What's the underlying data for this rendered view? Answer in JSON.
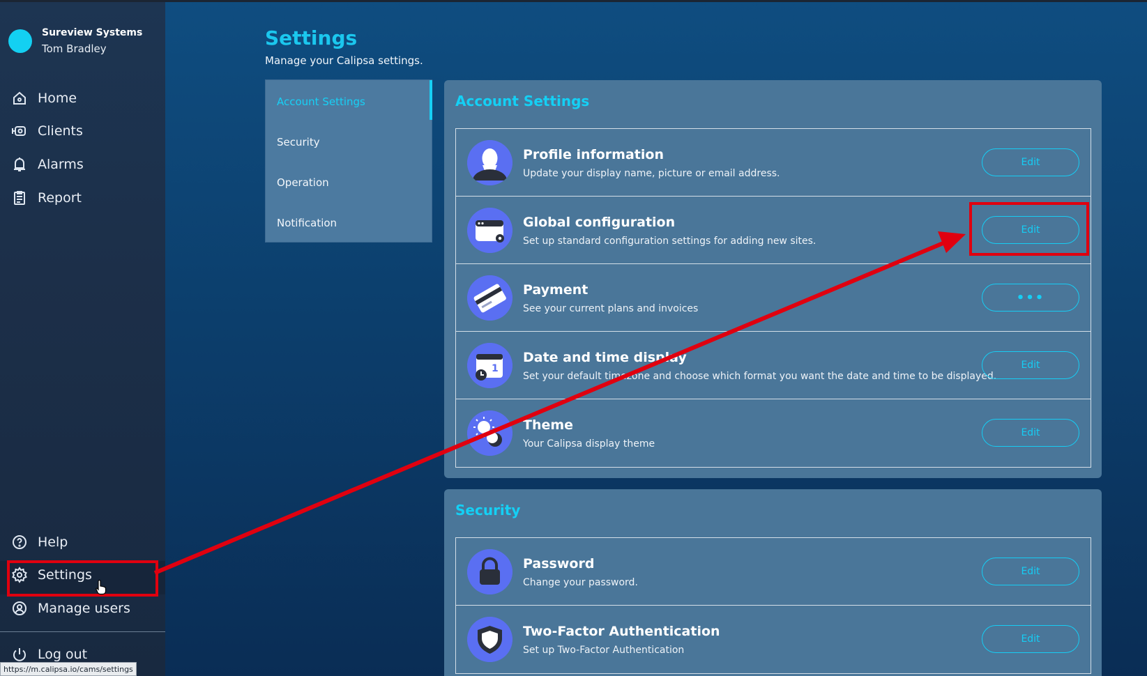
{
  "sidebar": {
    "org_name": "Sureview Systems",
    "user_name": "Tom Bradley",
    "nav_top": [
      {
        "label": "Home",
        "icon": "home-icon"
      },
      {
        "label": "Clients",
        "icon": "clients-icon"
      },
      {
        "label": "Alarms",
        "icon": "bell-icon"
      },
      {
        "label": "Report",
        "icon": "clipboard-icon"
      }
    ],
    "nav_bottom": [
      {
        "label": "Help",
        "icon": "help-icon"
      },
      {
        "label": "Settings",
        "icon": "gear-icon",
        "active": true
      },
      {
        "label": "Manage users",
        "icon": "user-icon"
      },
      {
        "label": "Log out",
        "icon": "power-icon"
      }
    ]
  },
  "status_url": "https://m.calipsa.io/cams/settings",
  "header": {
    "title": "Settings",
    "subtitle": "Manage your Calipsa settings."
  },
  "tabs": [
    {
      "label": "Account Settings",
      "active": true
    },
    {
      "label": "Security"
    },
    {
      "label": "Operation"
    },
    {
      "label": "Notification"
    }
  ],
  "account_panel": {
    "title": "Account Settings",
    "rows": [
      {
        "title": "Profile information",
        "desc": "Update your display name, picture or email address.",
        "button": "Edit",
        "icon": "profile-icon"
      },
      {
        "title": "Global configuration",
        "desc": "Set up standard configuration settings for adding new sites.",
        "button": "Edit",
        "icon": "browser-gear-icon"
      },
      {
        "title": "Payment",
        "desc": "See your current plans and invoices",
        "button": "•••",
        "icon": "credit-card-icon"
      },
      {
        "title": "Date and time display",
        "desc": "Set your default timezone and choose which format you want the date and time to be displayed.",
        "button": "Edit",
        "icon": "calendar-clock-icon"
      },
      {
        "title": "Theme",
        "desc": "Your Calipsa display theme",
        "button": "Edit",
        "icon": "theme-icon"
      }
    ]
  },
  "security_panel": {
    "title": "Security",
    "rows": [
      {
        "title": "Password",
        "desc": "Change your password.",
        "button": "Edit",
        "icon": "lock-icon"
      },
      {
        "title": "Two-Factor Authentication",
        "desc": "Set up Two-Factor Authentication",
        "button": "Edit",
        "icon": "shield-icon"
      }
    ]
  },
  "colors": {
    "accent": "#17d0f5",
    "annotation": "#e0000f",
    "sidebar_bg": "#1c2f49",
    "panel_bg": "#4a7699",
    "icon_circle": "#5a6ff2"
  }
}
